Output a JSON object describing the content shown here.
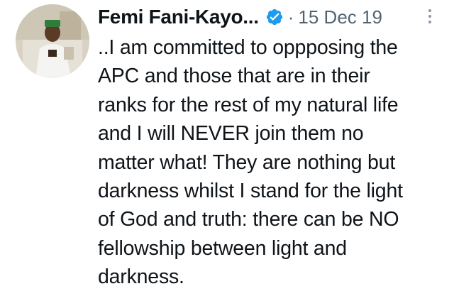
{
  "tweet": {
    "author_name": "Femi Fani-Kayo...",
    "separator": "·",
    "date": "15 Dec 19",
    "body_lines": [
      "..I am committed to oppposing the",
      "APC and those that are in their",
      "ranks for the rest of my natural life",
      "and I will NEVER join them no",
      "matter what! They are nothing but",
      "darkness whilst I stand for the light",
      "of God and truth: there can be NO",
      "fellowship between light and",
      "darkness."
    ]
  },
  "icons": {
    "verified": "verified-badge-icon",
    "more": "more-options-icon"
  },
  "colors": {
    "verified_blue": "#1d9bf0",
    "text": "#0f1419",
    "secondary": "#536471"
  }
}
